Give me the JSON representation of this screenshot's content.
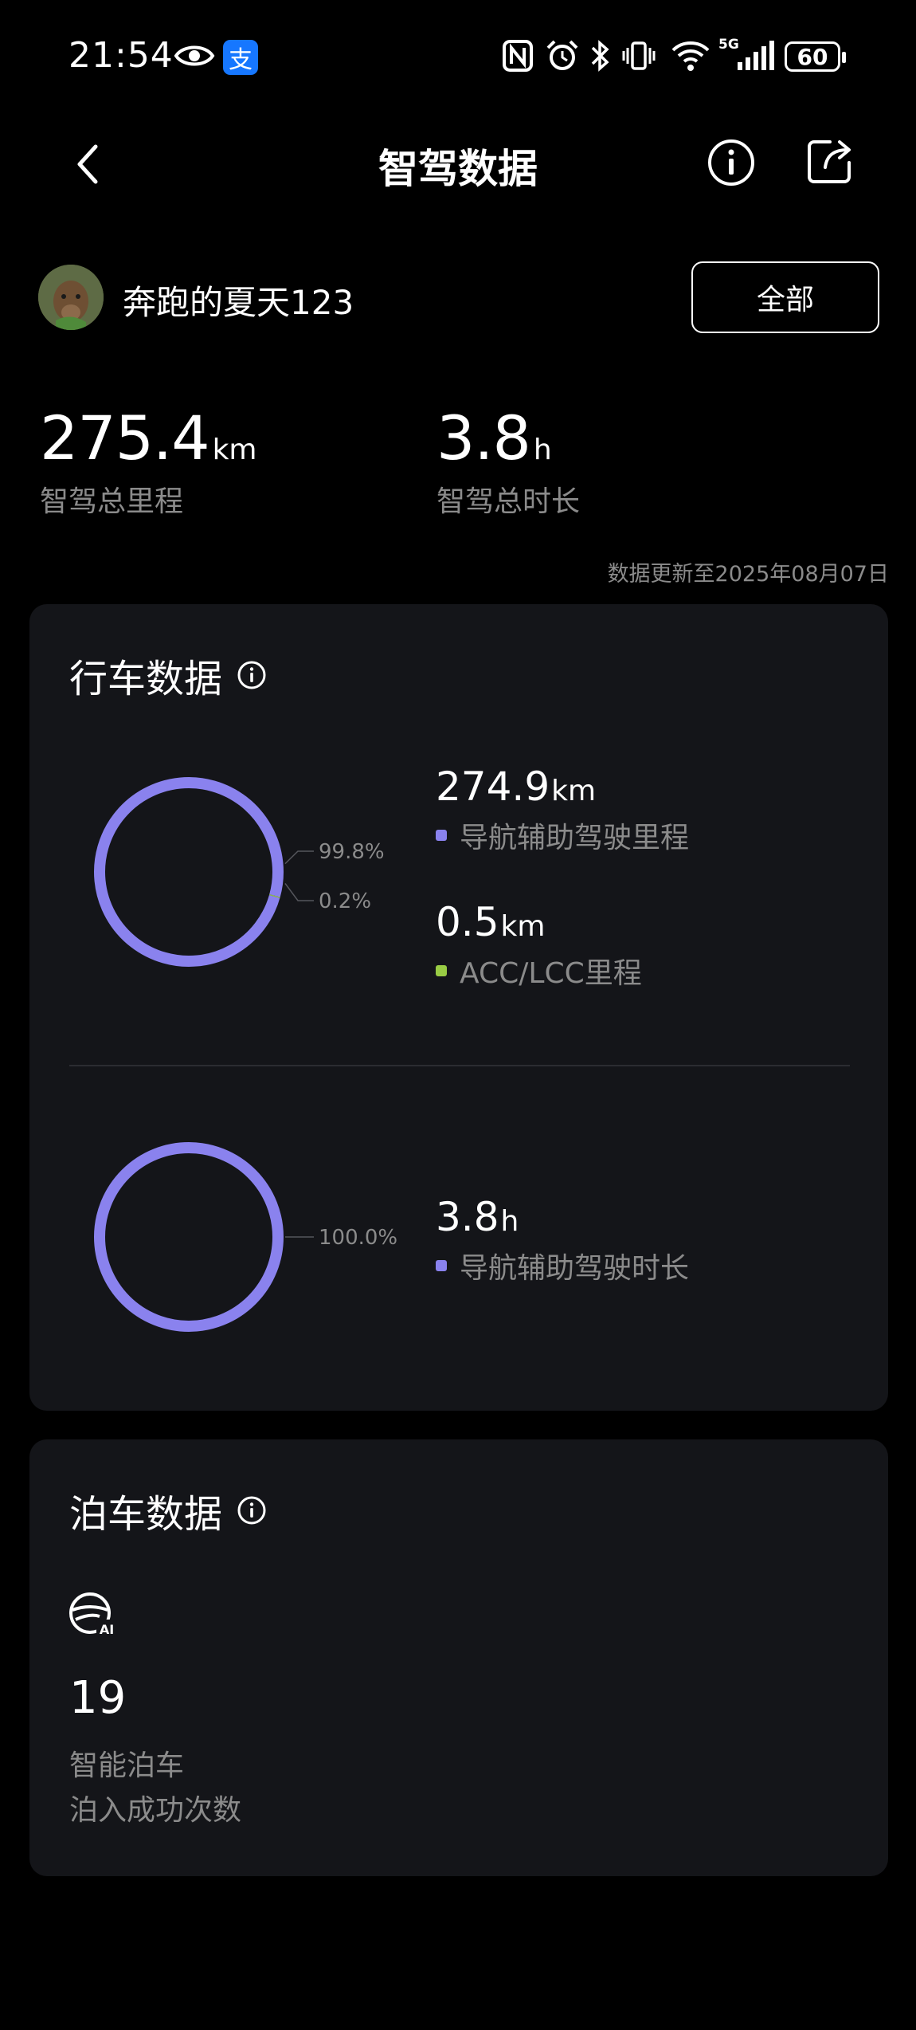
{
  "status_bar": {
    "time": "21:54",
    "alipay_glyph": "支",
    "battery": "60",
    "network": "5G",
    "icons": [
      "eye-icon",
      "alipay-icon",
      "nfc-icon",
      "alarm-icon",
      "bluetooth-icon",
      "vibrate-icon",
      "wifi-icon",
      "signal-icon",
      "battery-icon"
    ]
  },
  "header": {
    "title": "智驾数据",
    "icons": [
      "back-arrow-icon",
      "info-icon",
      "share-icon"
    ]
  },
  "user": {
    "name": "奔跑的夏天123",
    "filter_label": "全部"
  },
  "summary": {
    "total_distance": "275.4",
    "distance_unit": "km",
    "distance_label": "智驾总里程",
    "total_duration": "3.8",
    "duration_unit": "h",
    "duration_label": "智驾总时长",
    "update_note": "数据更新至2025年08月07日"
  },
  "colors": {
    "purple": "#8a82ee",
    "green": "#99cc44",
    "card_bg": "#141519",
    "muted": "#8b8b8b"
  },
  "driving": {
    "title": "行车数据",
    "distance_chart": {
      "segments": [
        {
          "percent": 99.8,
          "label": "99.8%",
          "color": "#8a82ee"
        },
        {
          "percent": 0.2,
          "label": "0.2%",
          "color": "#99cc44"
        }
      ]
    },
    "nav_distance": {
      "value": "274.9",
      "unit": "km",
      "label": "导航辅助驾驶里程"
    },
    "acc_distance": {
      "value": "0.5",
      "unit": "km",
      "label": "ACC/LCC里程"
    },
    "duration_chart": {
      "segments": [
        {
          "percent": 100.0,
          "label": "100.0%",
          "color": "#8a82ee"
        }
      ]
    },
    "nav_duration": {
      "value": "3.8",
      "unit": "h",
      "label": "导航辅助驾驶时长"
    }
  },
  "parking": {
    "title": "泊车数据",
    "icon": "steering-wheel-ai-icon",
    "ai_text": "AI",
    "count": "19",
    "label_line1": "智能泊车",
    "label_line2": "泊入成功次数"
  }
}
